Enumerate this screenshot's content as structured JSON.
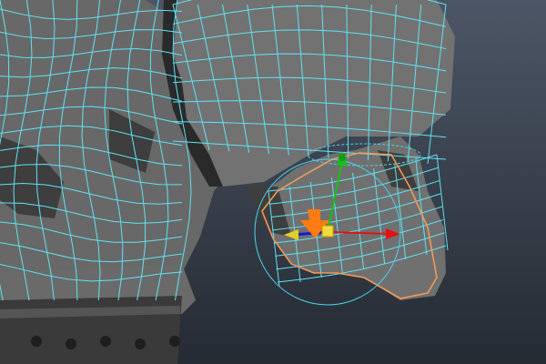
{
  "viewport": {
    "background_top": "#4c5666",
    "background_bottom": "#252b33"
  },
  "colors": {
    "mesh_fill": "#6f6f6f",
    "mesh_shadow": "#3a3a3a",
    "mesh_dark": "#252525",
    "wireframe": "#5fe4f2",
    "selection_outline": "#f09a58",
    "gizmo_circle": "#4fd2e8",
    "axis_x": "#e01414",
    "axis_y": "#16c016",
    "axis_z": "#1818d0",
    "axis_y_yellow": "#e0d020",
    "manipulator_handle": "#ff7a10",
    "belt": "#3c3c3c",
    "rivet": "#1e1e1e"
  },
  "icons": {
    "move_handle": "move-arrow-icon",
    "rotate_ring": "rotate-circle-icon"
  },
  "selection": {
    "tool": "move",
    "component": "faces"
  }
}
